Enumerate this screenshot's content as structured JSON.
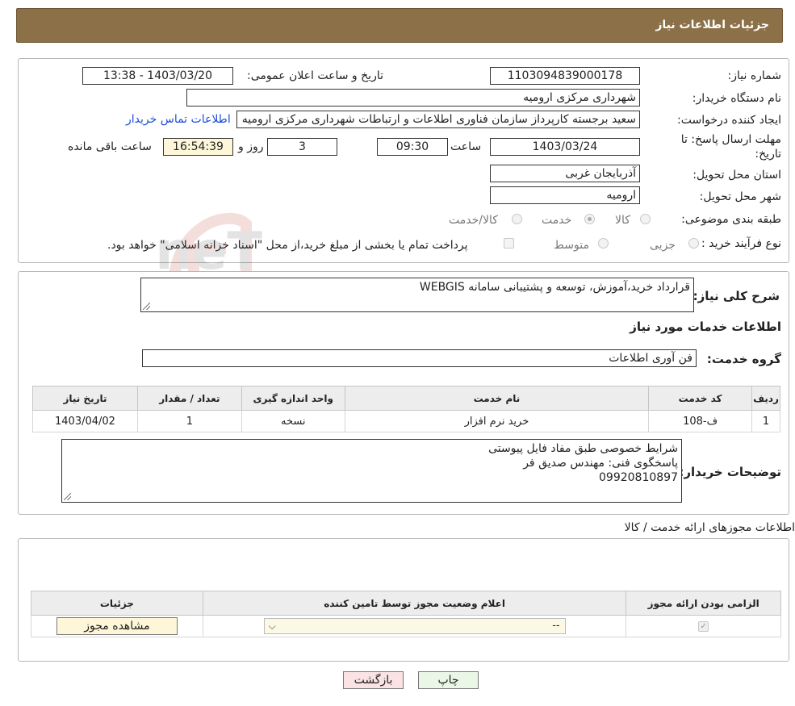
{
  "header": {
    "title": "جزئیات اطلاعات نیاز"
  },
  "fields": {
    "need_number_label": "شماره نیاز:",
    "need_number": "1103094839000178",
    "announce_label": "تاریخ و ساعت اعلان عمومی:",
    "announce_value": "1403/03/20 - 13:38",
    "buyer_org_label": "نام دستگاه خریدار:",
    "buyer_org": "شهرداری مرکزی ارومیه",
    "creator_label": "ایجاد کننده درخواست:",
    "creator": "سعید برجسته کارپرداز سازمان فناوری اطلاعات و ارتباطات شهرداری مرکزی ارومیه",
    "contact_link": "اطلاعات تماس خریدار",
    "deadline_label": "مهلت ارسال پاسخ: تا",
    "deadline_label2": "تاریخ:",
    "deadline_date": "1403/03/24",
    "time_label": "ساعت",
    "deadline_time": "09:30",
    "days": "3",
    "days_label": "روز و",
    "remaining": "16:54:39",
    "remaining_label": "ساعت باقی مانده",
    "province_label": "استان محل تحویل:",
    "province": "آذربایجان غربی",
    "city_label": "شهر محل تحویل:",
    "city": "ارومیه",
    "category_label": "طبقه بندی موضوعی:",
    "category_options": [
      "کالا",
      "خدمت",
      "کالا/خدمت"
    ],
    "category_selected": "خدمت",
    "process_label": "نوع فرآیند خرید :",
    "process_options": [
      "جزیی",
      "متوسط"
    ],
    "process_note": "پرداخت تمام یا بخشی از مبلغ خرید،از محل \"اسناد خزانه اسلامی\" خواهد بود."
  },
  "summary": {
    "desc_label": "شرح کلی نیاز:",
    "desc": "قرارداد خرید،آموزش، توسعه و پشتیبانی سامانه WEBGIS",
    "services_title": "اطلاعات خدمات مورد نیاز",
    "group_label": "گروه خدمت:",
    "group": "فن آوری اطلاعات"
  },
  "services_table": {
    "headers": [
      "ردیف",
      "کد خدمت",
      "نام خدمت",
      "واحد اندازه گیری",
      "تعداد / مقدار",
      "تاریخ نیاز"
    ],
    "rows": [
      [
        "1",
        "ف-108",
        "خرید نرم افزار",
        "نسخه",
        "1",
        "1403/04/02"
      ]
    ]
  },
  "buyer_notes": {
    "label": "توضیحات خریدار:",
    "line1": "شرایط خصوصی طبق مفاد فایل پیوستی",
    "line2": "پاسخگوی فنی: مهندس صدیق فر",
    "line3": "09920810897"
  },
  "permits": {
    "title": "اطلاعات مجوزهای ارائه خدمت / کالا",
    "headers": [
      "الزامی بودن ارائه مجوز",
      "اعلام وضعیت مجوز توسط تامین کننده",
      "جزئیات"
    ],
    "select_value": "--",
    "view_button": "مشاهده مجوز"
  },
  "buttons": {
    "print": "چاپ",
    "back": "بازگشت"
  },
  "watermark": {
    "text": "AriaTender.neT"
  },
  "colors": {
    "header_bg": "#8b7048",
    "link": "#1a4ddb",
    "back_bg": "#fbe3e3",
    "print_bg": "#eaf6e6",
    "remaining_bg": "#fdf6d8",
    "view_bg": "#fdf6d8",
    "select_bg": "#fcf8e6"
  }
}
